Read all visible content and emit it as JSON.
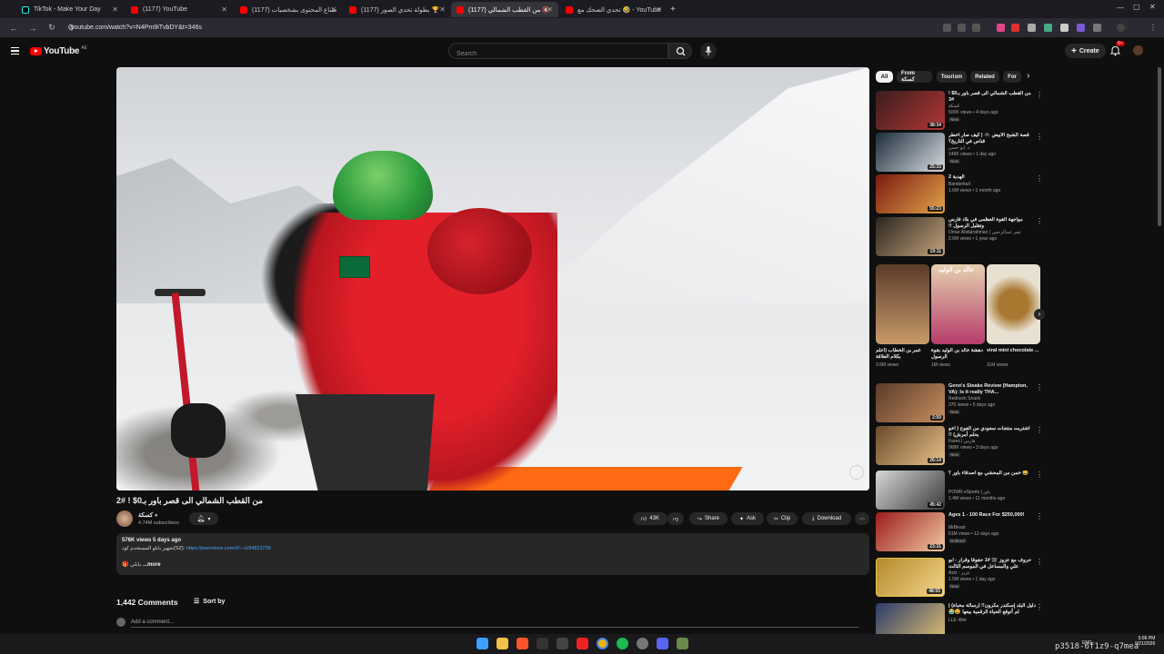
{
  "browser": {
    "tabs": [
      {
        "label": "TikTok - Make Your Day",
        "type": "tiktok"
      },
      {
        "label": "(1177) YouTube",
        "type": "yt"
      },
      {
        "label": "(1177) صناع المحتوى بشخصيات",
        "type": "yt"
      },
      {
        "label": "(1177) بطولة تحدي الصور 🏆",
        "type": "yt"
      },
      {
        "label": "(1177) من القطب الشمالي 🔇",
        "type": "yt"
      },
      {
        "label": "تحدي الضحك مع 🤣 - YouTube",
        "type": "yt"
      }
    ],
    "active_tab": 4,
    "url": "youtube.com/watch?v=N4Pm9iTvbDY&t=346s"
  },
  "header": {
    "logo_text": "YouTube",
    "country": "AE",
    "search_placeholder": "Search",
    "create_label": "Create",
    "notif_count": "9+"
  },
  "video": {
    "title": "من القطب الشمالي الى قصر باور بـ0$ ! #2",
    "channel": "كسكة",
    "subscribers": "4.74M subscribers",
    "likes": "43K",
    "share": "Share",
    "ask": "Ask",
    "clip": "Clip",
    "download": "Download",
    "desc_meta": "576K views  5 days ago",
    "desc_line_prefix": "تجهيز بابلو المستخدم كود(SZ): ",
    "desc_link": "https://pwnrstore.com/#/—/c94823739",
    "more": "...more",
    "more_prefix": "🎁 بابلي"
  },
  "comments": {
    "count": "1,442 Comments",
    "sort": "Sort by",
    "add": "Add a comment..."
  },
  "chips": [
    "All",
    "From كسكة",
    "Tourism",
    "Related",
    "For"
  ],
  "recs": [
    {
      "title": "من القطب الشمالي الى قصر باور بـ0$ ! #3",
      "channel": "كسكة",
      "views": "500K views • 4 days ago",
      "badge": "New",
      "dur": "38:34",
      "colors": [
        "#3b1d1d",
        "#b23636"
      ]
    },
    {
      "title": "قصة الشبح الأبيض 🕷️ | كيف صار أخطر قناص في التاريخ؟",
      "channel": "د. أبو حسن",
      "views": "146K views • 1 day ago",
      "badge": "New",
      "dur": "25:33",
      "colors": [
        "#1c2b3a",
        "#d8dde2"
      ]
    },
    {
      "title": "الهدية 2",
      "channel": "BanderitaX",
      "views": "1.6M views • 1 month ago",
      "badge": "",
      "dur": "55:23",
      "colors": [
        "#7a1a10",
        "#e2a34a"
      ]
    },
    {
      "title": "مواجهة القوة العظمى في بلاد فارس وتقلبل الرسول !!",
      "channel": "Omar Abdulrahman | عمر عبدالرحمن",
      "views": "2.6M views • 1 year ago",
      "badge": "",
      "dur": "19:11",
      "colors": [
        "#2a2520",
        "#c4a27a"
      ]
    },
    {
      "title": "Geno's Steaks Review (Hampton, VA): Is it really THA...",
      "channel": "Redneck Snack",
      "views": "370 views • 5 days ago",
      "badge": "New",
      "dur": "2:50",
      "colors": [
        "#5a3a2a",
        "#c78f5f"
      ]
    },
    {
      "title": "اشتريت منتجات سعودي من الفوج ( اخو يحلم أمرش) !!",
      "channel": "Fares | فارس",
      "views": "968K views • 3 days ago",
      "badge": "New",
      "dur": "26:14",
      "colors": [
        "#6a4a2a",
        "#e8c08a"
      ]
    },
    {
      "title": "😂 خمن من المحشي مع اصدقاء باور ؟",
      "channel": "POWR eSports | باور",
      "views": "1.4M views • 11 months ago",
      "badge": "",
      "dur": "45:42",
      "colors": [
        "#d8d8d8",
        "#3a3a3a"
      ]
    },
    {
      "title": "Ages 1 - 100 Race For $250,000!",
      "channel": "MrBeast",
      "views": "61M views • 12 days ago",
      "badge": "Dubbed",
      "dur": "23:31",
      "colors": [
        "#9b1b1b",
        "#f1c9a0"
      ]
    },
    {
      "title": "حروف مع عزوز 🎬 #1 حقوقا وقرار - ابو علي والمساعل في الموسم الثالث",
      "channel": "Aziz - عزيز",
      "views": "1.5M views • 1 day ago",
      "badge": "New",
      "dur": "48:55",
      "colors": [
        "#b38a2a",
        "#f4d38a"
      ]
    },
    {
      "title": "دليل البلد إسكندر مكرون!! (رسالة مخبأة) | لم أتوقع الحياة الرقمية بيعها 😂😭",
      "channel": "LLE •lifer",
      "views": "",
      "badge": "",
      "dur": "",
      "colors": [
        "#2a3a6a",
        "#e0c070"
      ]
    }
  ],
  "shorts": [
    {
      "title": "عمر بن الخطاب (اعلم بكلام العلاقة",
      "views": "3.6M views",
      "colors": [
        "#5a3b2a",
        "#c89a6a"
      ]
    },
    {
      "title": "دهشة خالد بن الوليد بقوة الرسول",
      "views": "1M views",
      "overlay": "خالد بن الوليد",
      "colors": [
        "#b53c6a",
        "#e6d0b0"
      ]
    },
    {
      "title": "viral mini chocolate ...",
      "views": "11M views",
      "colors": [
        "#e8e0d0",
        "#a87830"
      ]
    }
  ],
  "taskbar": {
    "time": "5:06 PM",
    "date": "9/21/2026",
    "lang": "ENG"
  },
  "watermark": "p3518-6f1z9-q7mea"
}
